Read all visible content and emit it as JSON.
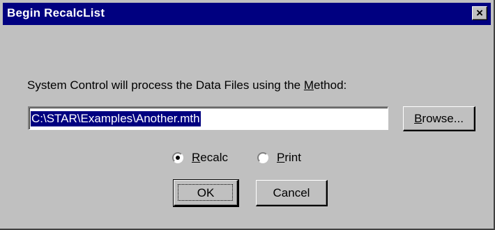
{
  "window": {
    "title": "Begin RecalcList",
    "close_glyph": "×"
  },
  "prompt": {
    "before": "System Control will process the Data Files using the ",
    "accel": "M",
    "after": "ethod:"
  },
  "method_path": {
    "value": "C:\\STAR\\Examples\\Another.mth"
  },
  "buttons": {
    "browse": {
      "accel": "B",
      "rest": "rowse..."
    },
    "ok": "OK",
    "cancel": "Cancel"
  },
  "mode": {
    "recalc": {
      "accel": "R",
      "rest": "ecalc",
      "selected": true
    },
    "print": {
      "accel": "P",
      "rest": "rint",
      "selected": false
    }
  },
  "colors": {
    "dialog_bg": "#c0c0c0",
    "titlebar_bg": "#000080",
    "selection_bg": "#000080"
  }
}
